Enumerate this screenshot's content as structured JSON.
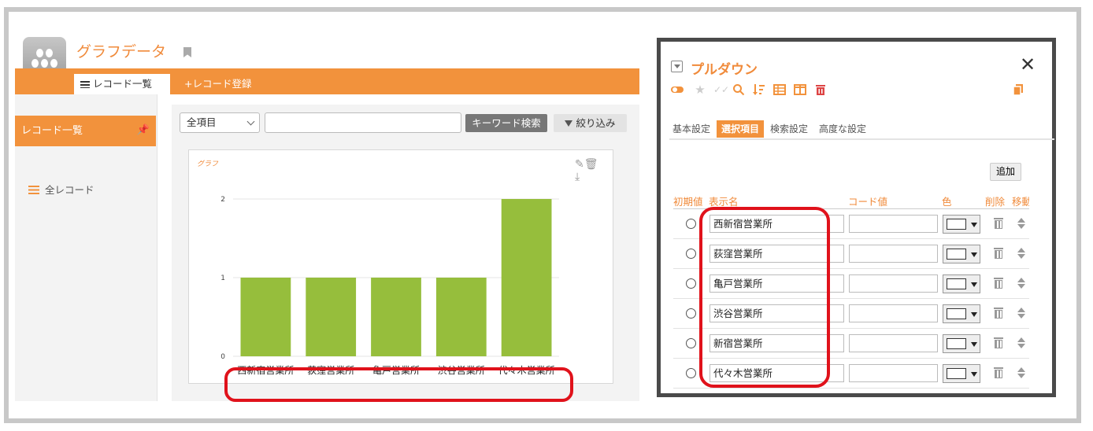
{
  "app": {
    "title": "グラフデータ",
    "tabs": [
      {
        "label": "レコード一覧",
        "icon": "list-icon"
      },
      {
        "label": "+レコード登録",
        "icon": "plus-icon"
      }
    ]
  },
  "sidebar": {
    "header": "レコード一覧",
    "items": [
      {
        "label": "全レコード",
        "icon": "list-icon"
      }
    ]
  },
  "search": {
    "field_select": "全項目",
    "keyword_value": "",
    "keyword_button": "キーワード検索",
    "filter_button": "絞り込み"
  },
  "chart_data": {
    "type": "bar",
    "title": "グラフ",
    "categories": [
      "西新宿営業所",
      "荻窪営業所",
      "亀戸営業所",
      "渋谷営業所",
      "代々木営業所"
    ],
    "values": [
      1,
      1,
      1,
      1,
      2
    ],
    "ylim": [
      0,
      2
    ],
    "yticks": [
      "0",
      "1",
      "2"
    ],
    "bar_color": "#96be3c",
    "grid": true
  },
  "dialog": {
    "title": "プルダウン",
    "tabs": [
      "基本設定",
      "選択項目",
      "検索設定",
      "高度な設定"
    ],
    "active_tab": "選択項目",
    "add_button": "追加",
    "columns": [
      "初期値",
      "表示名",
      "コード値",
      "色",
      "削除",
      "移動"
    ],
    "options": [
      {
        "name": "西新宿営業所",
        "code": ""
      },
      {
        "name": "荻窪営業所",
        "code": ""
      },
      {
        "name": "亀戸営業所",
        "code": ""
      },
      {
        "name": "渋谷営業所",
        "code": ""
      },
      {
        "name": "新宿営業所",
        "code": ""
      },
      {
        "name": "代々木営業所",
        "code": ""
      }
    ]
  },
  "colors": {
    "accent": "#f2923c",
    "highlight": "#e0121b",
    "bar": "#96be3c"
  }
}
